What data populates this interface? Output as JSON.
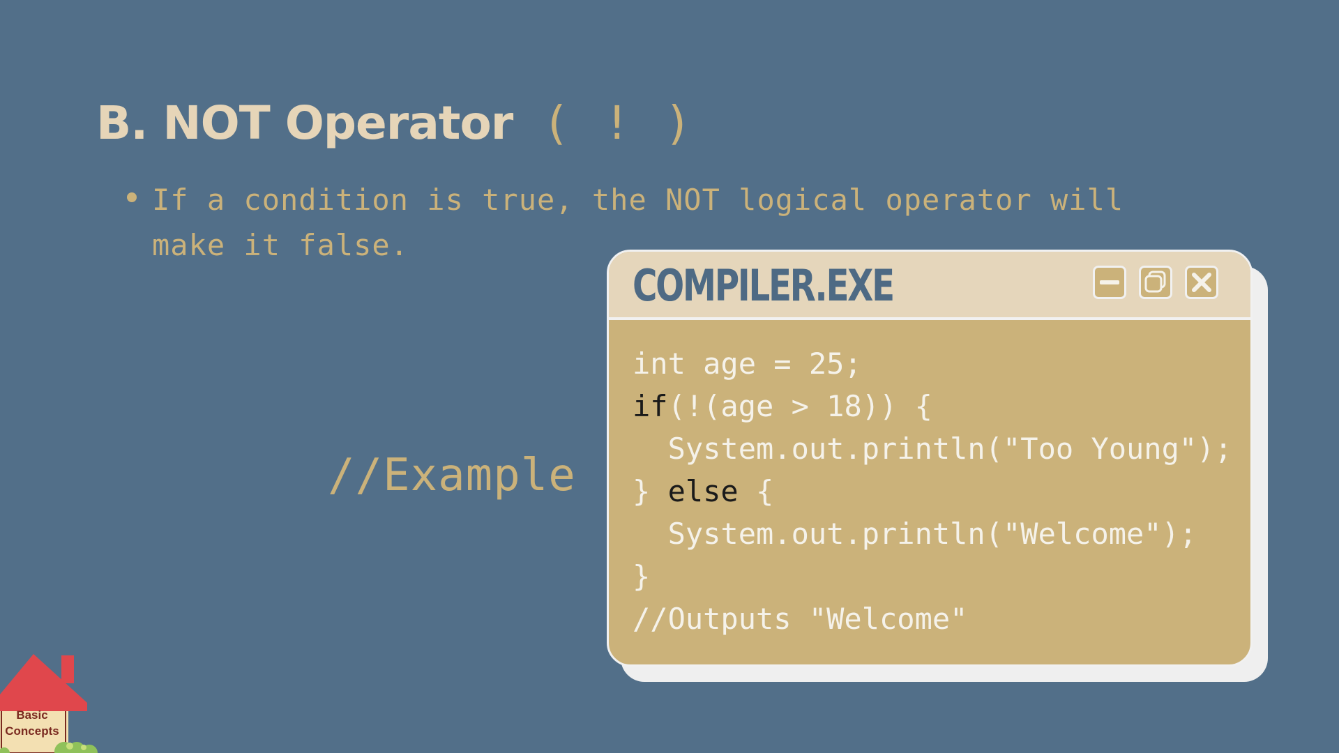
{
  "slide": {
    "title": "B. NOT Operator",
    "title_symbol": "( ! )",
    "bullet_line1": "If a condition is true, the NOT logical operator will",
    "bullet_line2": "make it false.",
    "example_label": "//Example"
  },
  "window": {
    "title": "COMPILER.EXE",
    "controls": [
      "minimize-icon",
      "restore-icon",
      "close-icon"
    ],
    "code": {
      "l1": "int age = 25;",
      "l2_kw": "if",
      "l2_rest": "(!(age > 18)) {",
      "l3": "  System.out.println(\"Too Young\");",
      "l4_a": "} ",
      "l4_kw": "else",
      "l4_b": " {",
      "l5": "  System.out.println(\"Welcome\");",
      "l6": "}",
      "l7": "//Outputs \"Welcome\""
    }
  },
  "corner_badge": {
    "line1": "Basic",
    "line2": "Concepts"
  },
  "colors": {
    "background": "#526f89",
    "accent_tan": "#cbb27a",
    "title_cream": "#e6d5b8",
    "roof_red": "#e0474c"
  }
}
